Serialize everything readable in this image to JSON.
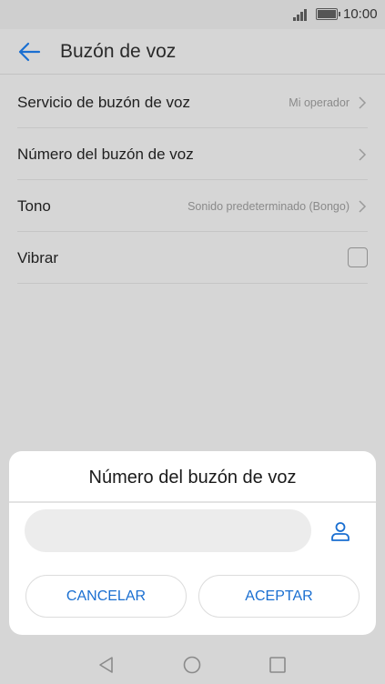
{
  "status_bar": {
    "time": "10:00"
  },
  "app_bar": {
    "title": "Buzón de voz"
  },
  "settings": [
    {
      "label": "Servicio de buzón de voz",
      "value": "Mi operador",
      "control": "chevron"
    },
    {
      "label": "Número del buzón de voz",
      "value": "",
      "control": "chevron"
    },
    {
      "label": "Tono",
      "value": "Sonido predeterminado (Bongo)",
      "control": "chevron"
    },
    {
      "label": "Vibrar",
      "value": "",
      "control": "checkbox",
      "checked": false
    }
  ],
  "dialog": {
    "title": "Número del buzón de voz",
    "input_value": "",
    "cancel_label": "CANCELAR",
    "ok_label": "ACEPTAR"
  },
  "colors": {
    "accent": "#1a6fd1",
    "background": "#d6d6d6",
    "dialog": "#ffffff"
  },
  "icons": {
    "back": "arrow-left-icon",
    "contact": "person-icon",
    "nav": [
      "back-triangle-icon",
      "home-circle-icon",
      "recents-square-icon"
    ]
  }
}
